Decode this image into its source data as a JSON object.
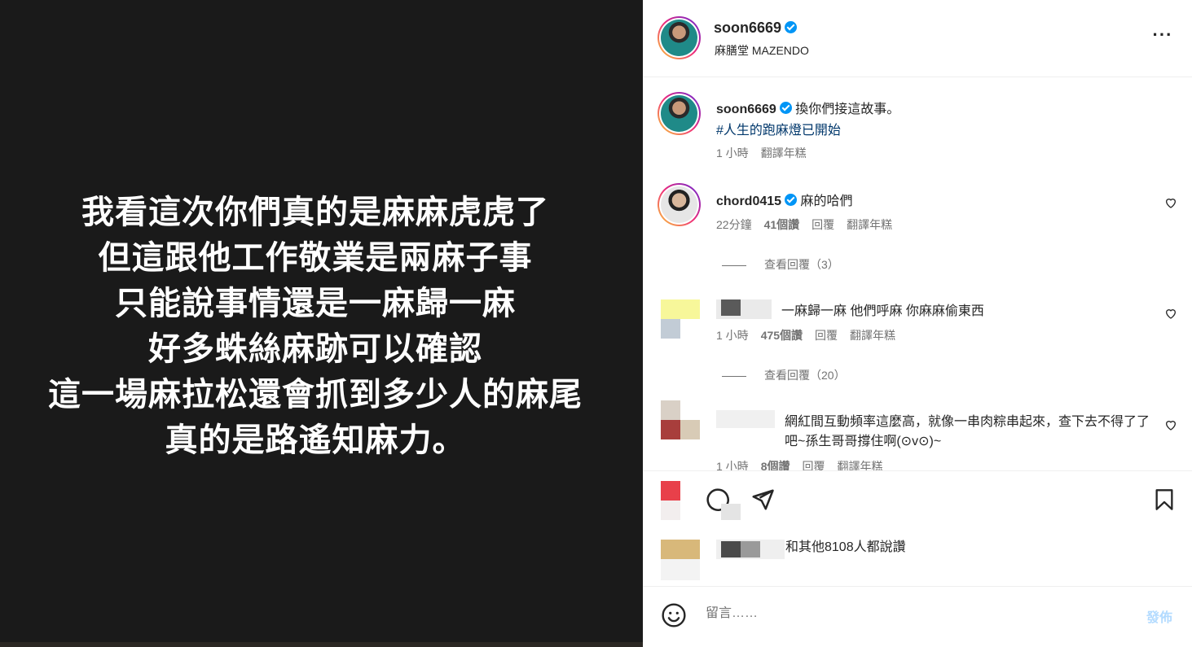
{
  "media": {
    "lines": [
      "我看這次你們真的是麻麻虎虎了",
      "但這跟他工作敬業是兩麻子事",
      "只能說事情還是一麻歸一麻",
      "好多蛛絲麻跡可以確認",
      "這一場麻拉松還會抓到多少人的麻尾",
      "真的是路遙知麻力。"
    ]
  },
  "header": {
    "username": "soon6669",
    "subtitle": "麻膳堂 MAZENDO",
    "more_icon": "more-horizontal-icon"
  },
  "caption": {
    "username": "soon6669",
    "text": "換你們接這故事。",
    "hashtag": "#人生的跑麻燈已開始",
    "time": "1 小時",
    "translate": "翻譯年糕"
  },
  "comments": [
    {
      "username": "chord0415",
      "text": "麻的哈們",
      "time": "22分鐘",
      "likes": "41個讚",
      "reply": "回覆",
      "translate": "翻譯年糕",
      "view_replies": "查看回覆（3）"
    },
    {
      "username": "",
      "text": "一麻歸一麻 他們呼麻 你麻麻偷東西",
      "time": "1 小時",
      "likes": "475個讚",
      "reply": "回覆",
      "translate": "翻譯年糕",
      "view_replies": "查看回覆（20）"
    },
    {
      "username": "",
      "text": "網紅間互動頻率這麼高，就像一串肉粽串起來，查下去不得了了吧~孫生哥哥撐住啊(⊙v⊙)~",
      "time": "1 小時",
      "likes": "8個讚",
      "reply": "回覆",
      "translate": "翻譯年糕"
    }
  ],
  "actions": {
    "likes_text": "和其他8108人都說讚"
  },
  "composer": {
    "placeholder": "留言……",
    "post_label": "發佈"
  }
}
